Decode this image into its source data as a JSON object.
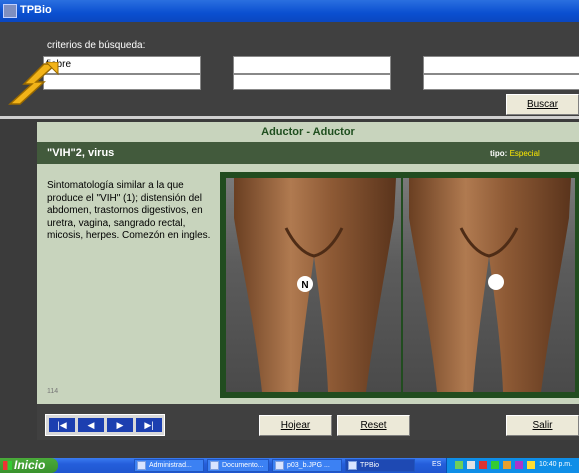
{
  "window": {
    "title": "TPBio"
  },
  "search": {
    "label": "criterios de búsqueda:",
    "field1_value": "fiebre",
    "button_label": "Buscar"
  },
  "header": {
    "muscles": "Aductor   -   Aductor"
  },
  "item": {
    "name": "\"VIH\"2, virus",
    "tipo_label": "tipo:",
    "tipo_value": "Especial",
    "description": "Sintomatología similar a la que produce el \"VIH\" (1); distensión del abdomen, trastornos digestivos, en uretra, vagina, sangrado rectal, micosis, herpes. Comezón en ingles.",
    "number": "114",
    "marker_label": "N"
  },
  "nav": {
    "first": "|◀",
    "prev": "◀",
    "next": "▶",
    "last": "▶|",
    "hojear": "Hojear",
    "reset": "Reset",
    "salir": "Salir"
  },
  "taskbar": {
    "start": "Inicio",
    "items": [
      "Administrad...",
      "Documento...",
      "p03_b.JPG ...",
      "TPBio"
    ],
    "lang": "ES",
    "clock": "10:40 p.m."
  }
}
